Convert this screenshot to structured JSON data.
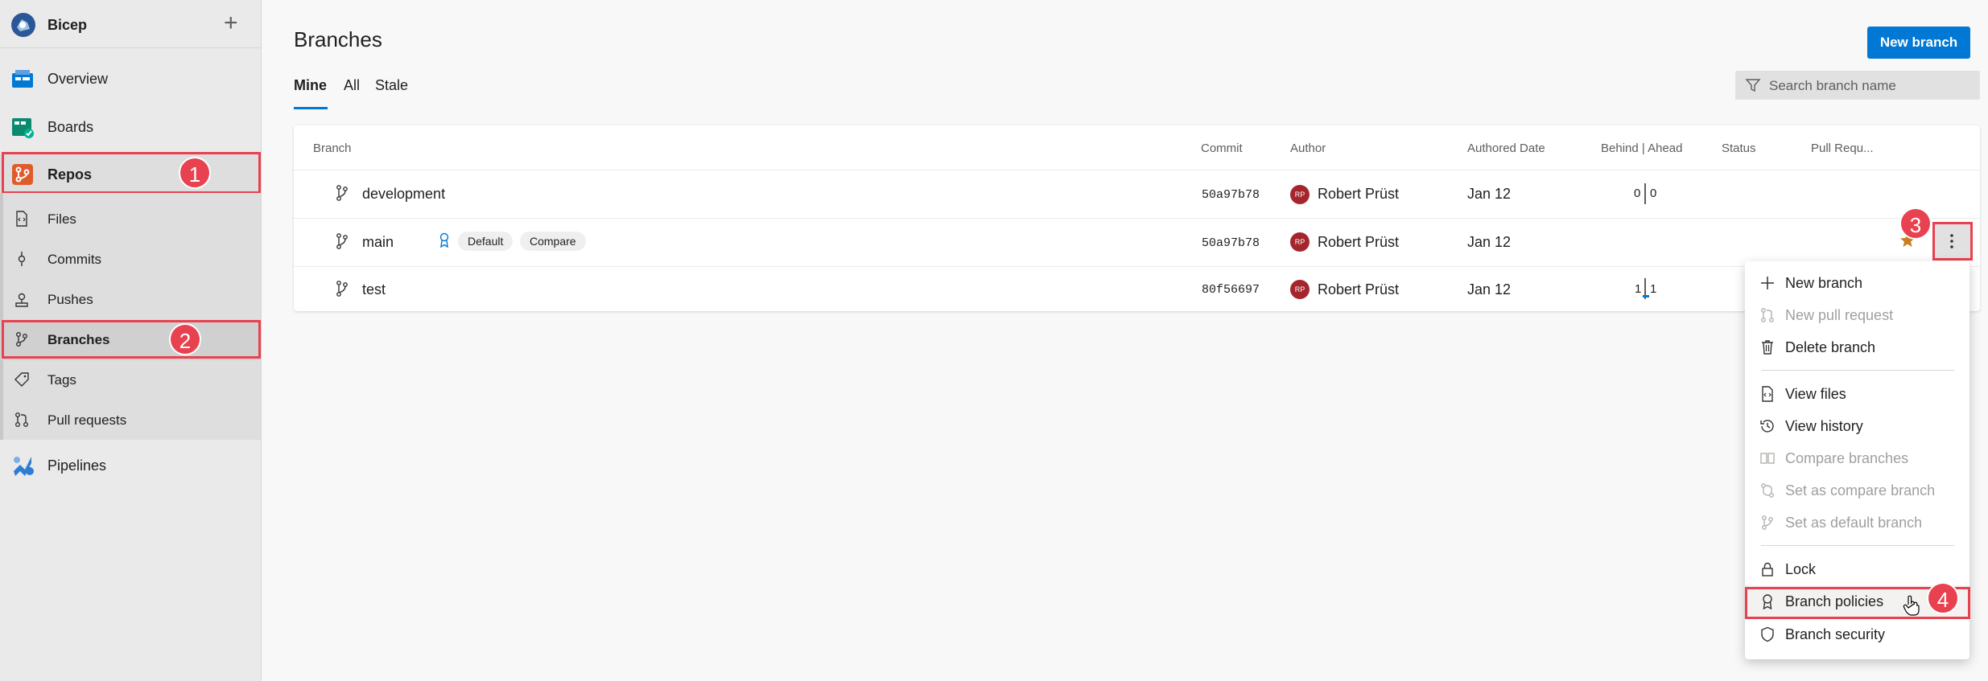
{
  "project": {
    "name": "Bicep"
  },
  "nav": {
    "overview": "Overview",
    "boards": "Boards",
    "repos": "Repos",
    "pipelines": "Pipelines"
  },
  "repos_sub": {
    "files": "Files",
    "commits": "Commits",
    "pushes": "Pushes",
    "branches": "Branches",
    "tags": "Tags",
    "pull_requests": "Pull requests"
  },
  "page": {
    "title": "Branches",
    "new_branch": "New branch",
    "tabs": [
      "Mine",
      "All",
      "Stale"
    ],
    "active_tab": "Mine",
    "search_placeholder": "Search branch name"
  },
  "table": {
    "headers": {
      "branch": "Branch",
      "commit": "Commit",
      "author": "Author",
      "authored_date": "Authored Date",
      "behind_ahead": "Behind | Ahead",
      "status": "Status",
      "pull_request": "Pull Requ..."
    },
    "rows": [
      {
        "name": "development",
        "commit": "50a97b78",
        "avatar": "RP",
        "author": "Robert Prüst",
        "date": "Jan 12",
        "behind": "0",
        "ahead": "0"
      },
      {
        "name": "main",
        "commit": "50a97b78",
        "avatar": "RP",
        "author": "Robert Prüst",
        "date": "Jan 12",
        "badge_default": "Default",
        "badge_compare": "Compare"
      },
      {
        "name": "test",
        "commit": "80f56697",
        "avatar": "RP",
        "author": "Robert Prüst",
        "date": "Jan 12",
        "behind": "1",
        "ahead": "1"
      }
    ]
  },
  "menu": {
    "new_branch": "New branch",
    "new_pull_request": "New pull request",
    "delete_branch": "Delete branch",
    "view_files": "View files",
    "view_history": "View history",
    "compare_branches": "Compare branches",
    "set_compare": "Set as compare branch",
    "set_default": "Set as default branch",
    "lock": "Lock",
    "branch_policies": "Branch policies",
    "branch_security": "Branch security"
  },
  "callouts": [
    "1",
    "2",
    "3",
    "4"
  ],
  "colors": {
    "accent": "#0078d4",
    "highlight": "#e8414f",
    "star": "#c87f1d"
  }
}
